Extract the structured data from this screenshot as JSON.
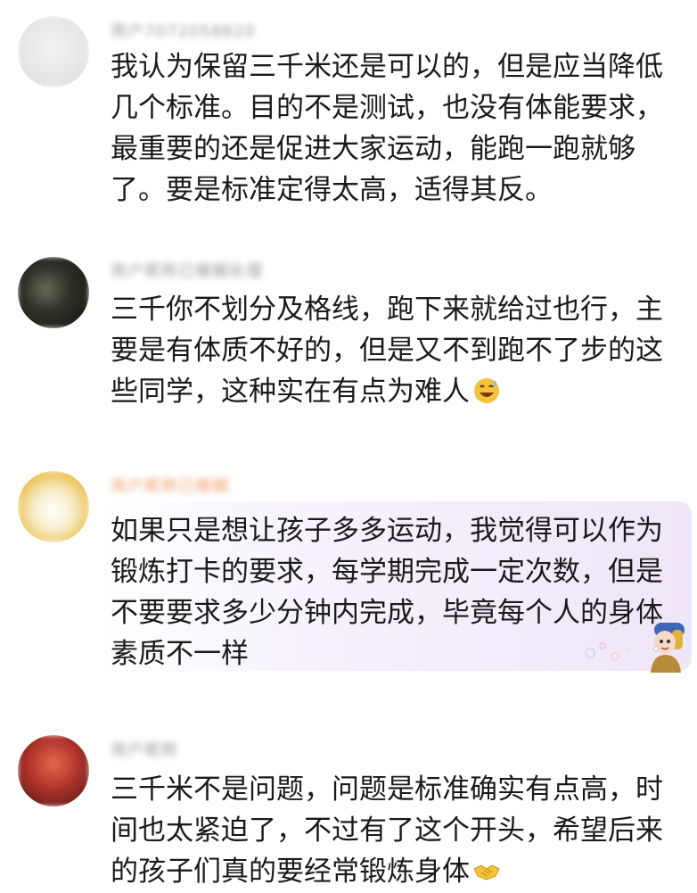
{
  "comments": [
    {
      "username": "用户7072058820",
      "text": "我认为保留三千米还是可以的，但是应当降低几个标准。目的不是测试，也没有体能要求，最重要的还是促进大家运动，能跑一跑就够了。要是标准定得太高，适得其反。",
      "emoji": ""
    },
    {
      "username": "用户昵称已模糊处理",
      "text": "三千你不划分及格线，跑下来就给过也行，主要是有体质不好的，但是又不到跑不了步的这些同学，这种实在有点为难人",
      "emoji": "sweat-smile-emoji"
    },
    {
      "username": "用户昵称已模糊",
      "text": "如果只是想让孩子多多运动，我觉得可以作为锻炼打卡的要求，每学期完成一定次数，但是不要要求多少分钟内完成，毕竟每个人的身体素质不一样",
      "emoji": ""
    },
    {
      "username": "用户昵称",
      "text": "三千米不是问题，问题是标准确实有点高，时间也太紧迫了，不过有了这个开头，希望后来的孩子们真的要经常锻炼身体",
      "emoji": "handshake-emoji"
    }
  ],
  "colors": {
    "text": "#1a1a1a",
    "username_gray": "#9a9a9a",
    "username_orange": "#f0a070",
    "bubble": "#efe6f8"
  }
}
